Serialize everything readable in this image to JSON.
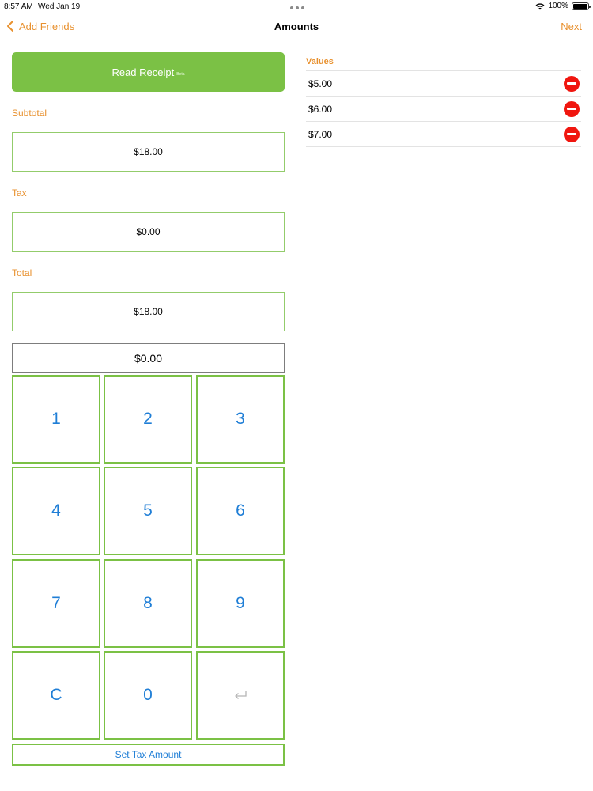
{
  "status_bar": {
    "time": "8:57 AM",
    "date": "Wed Jan 19",
    "battery": "100%"
  },
  "nav": {
    "back_label": "Add Friends",
    "title": "Amounts",
    "next_label": "Next"
  },
  "read_receipt": {
    "label": "Read Receipt",
    "badge": "Beta"
  },
  "subtotal": {
    "label": "Subtotal",
    "value": "$18.00"
  },
  "tax": {
    "label": "Tax",
    "value": "$0.00"
  },
  "total": {
    "label": "Total",
    "value": "$18.00"
  },
  "entry_display": "$0.00",
  "keypad": {
    "k1": "1",
    "k2": "2",
    "k3": "3",
    "k4": "4",
    "k5": "5",
    "k6": "6",
    "k7": "7",
    "k8": "8",
    "k9": "9",
    "clear": "C",
    "k0": "0",
    "enter_icon": "return-arrow-icon"
  },
  "set_tax_label": "Set Tax Amount",
  "values": {
    "header": "Values",
    "items": [
      {
        "amount": "$5.00"
      },
      {
        "amount": "$6.00"
      },
      {
        "amount": "$7.00"
      }
    ]
  },
  "colors": {
    "accent_orange": "#e8912f",
    "green": "#7bc145",
    "key_blue": "#1f7ed6",
    "remove_red": "#f0160f"
  }
}
